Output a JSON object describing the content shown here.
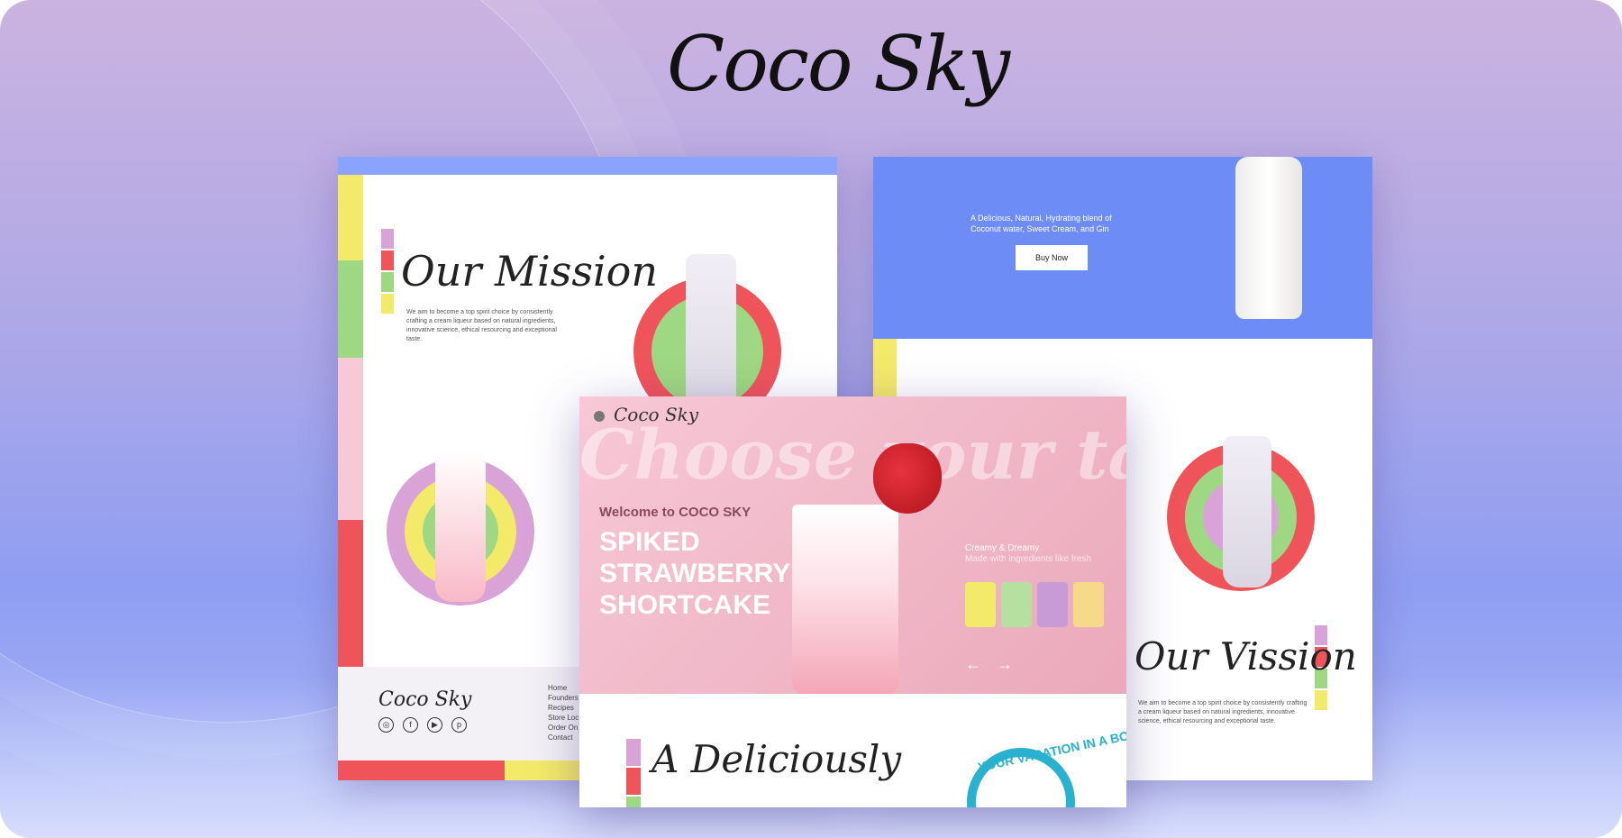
{
  "brand": {
    "logo": "Coco Sky"
  },
  "left_card": {
    "mission_title": "Our Mission",
    "mission_text": "We aim to become a top spirit choice by consistently crafting a cream liqueur based on natural ingredients, innovative science, ethical resourcing and exceptional taste.",
    "footer_logo": "Coco Sky",
    "footer_links": [
      "Home",
      "Founders",
      "Recipes",
      "Store Loc",
      "Order On",
      "Contact"
    ],
    "socials": [
      "instagram-icon",
      "facebook-icon",
      "youtube-icon",
      "pinterest-icon"
    ]
  },
  "right_card": {
    "hero_text": "A Delicious, Natural, Hydrating  blend of Coconut water, Sweet Cream, and Gin",
    "buy_button": "Buy Now",
    "vision_title": "Our Vission",
    "vision_text": "We aim to become a top spirit choice by consistently crafting a cream liqueur based on natural ingredients, innovative science, ethical resourcing and exceptional taste."
  },
  "center_card": {
    "logo": "Coco Sky",
    "watermark": "Choose your taste",
    "welcome": "Welcome to COCO SKY",
    "headline": [
      "SPIKED",
      "STRAWBERRY",
      "SHORTCAKE"
    ],
    "side_title": "Creamy & Dreamy",
    "side_sub": "Made with ingredients like fresh",
    "arrows": "← →",
    "bottom_title": "A Deliciously",
    "badge_text": "YOUR VACATION IN A BOTTLE"
  },
  "colors": {
    "blue": "#6d8cf5",
    "pink": "#f7c8d6",
    "yellow": "#f4ea6a",
    "green": "#9ed882",
    "red": "#f0545b",
    "lavender": "#d9a3d8",
    "teal": "#29b1cf"
  }
}
